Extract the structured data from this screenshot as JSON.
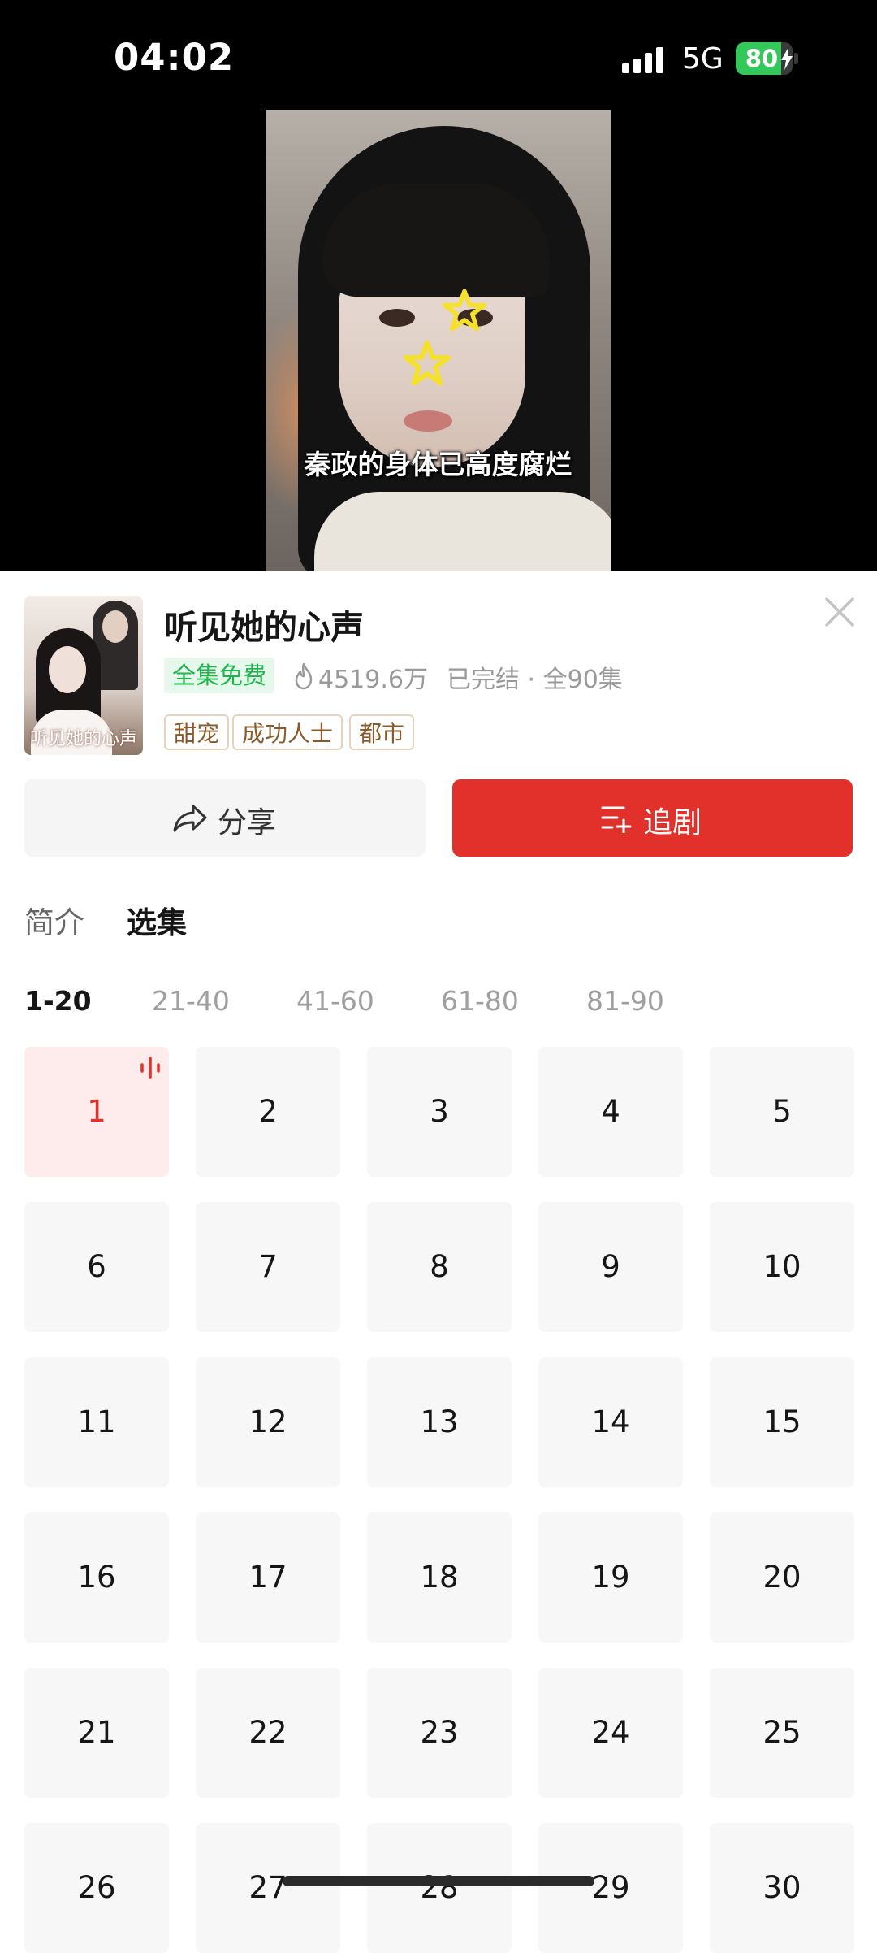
{
  "status_bar": {
    "time": "04:02",
    "network": "5G",
    "battery": "80",
    "battery_level": 0.8
  },
  "video": {
    "subtitle": "秦政的身体已高度腐烂"
  },
  "drama": {
    "poster_title": "听见她的心声",
    "title": "听见她的心声",
    "free_badge": "全集免费",
    "views": "4519.6万",
    "status": "已完结 · 全90集",
    "tags": [
      "甜宠",
      "成功人士",
      "都市"
    ]
  },
  "actions": {
    "share_label": "分享",
    "follow_label": "追剧"
  },
  "tabs": {
    "intro": "简介",
    "episodes": "选集"
  },
  "ranges": [
    "1-20",
    "21-40",
    "41-60",
    "61-80",
    "81-90"
  ],
  "active_range": "1-20",
  "episodes": [
    "1",
    "2",
    "3",
    "4",
    "5",
    "6",
    "7",
    "8",
    "9",
    "10",
    "11",
    "12",
    "13",
    "14",
    "15",
    "16",
    "17",
    "18",
    "19",
    "20",
    "21",
    "22",
    "23",
    "24",
    "25",
    "26",
    "27",
    "28",
    "29",
    "30"
  ],
  "current_episode": "1",
  "colors": {
    "accent": "#e2312a",
    "free_green": "#1fb54c",
    "battery_green": "#34c759",
    "tag_brown": "#8a5a2b"
  }
}
